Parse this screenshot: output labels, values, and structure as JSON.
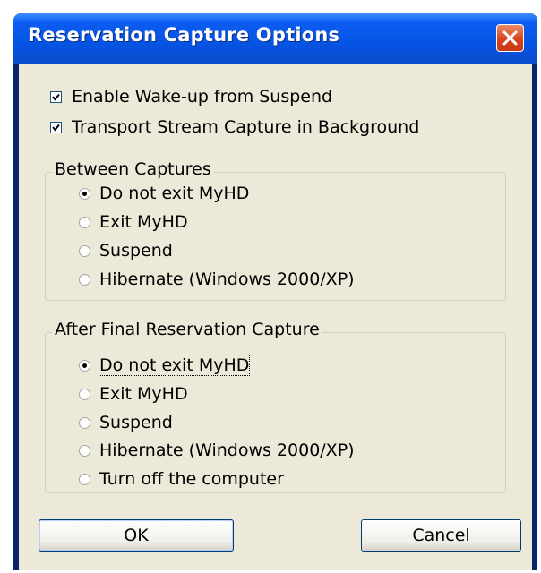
{
  "window": {
    "title": "Reservation Capture Options"
  },
  "options": {
    "wakeup": {
      "label": "Enable Wake-up from Suspend",
      "checked": true
    },
    "background": {
      "label": "Transport Stream Capture in Background",
      "checked": true
    }
  },
  "between": {
    "title": "Between Captures",
    "items": [
      {
        "label": "Do not exit MyHD",
        "selected": true
      },
      {
        "label": "Exit MyHD",
        "selected": false
      },
      {
        "label": "Suspend",
        "selected": false
      },
      {
        "label": "Hibernate (Windows 2000/XP)",
        "selected": false
      }
    ]
  },
  "after": {
    "title": "After Final Reservation Capture",
    "items": [
      {
        "label": "Do not exit MyHD",
        "selected": true
      },
      {
        "label": "Exit MyHD",
        "selected": false
      },
      {
        "label": "Suspend",
        "selected": false
      },
      {
        "label": "Hibernate (Windows 2000/XP)",
        "selected": false
      },
      {
        "label": "Turn off the computer",
        "selected": false
      }
    ]
  },
  "buttons": {
    "ok": "OK",
    "cancel": "Cancel"
  },
  "icons": {
    "close": "close-icon",
    "checkmark": "checkmark-icon"
  }
}
